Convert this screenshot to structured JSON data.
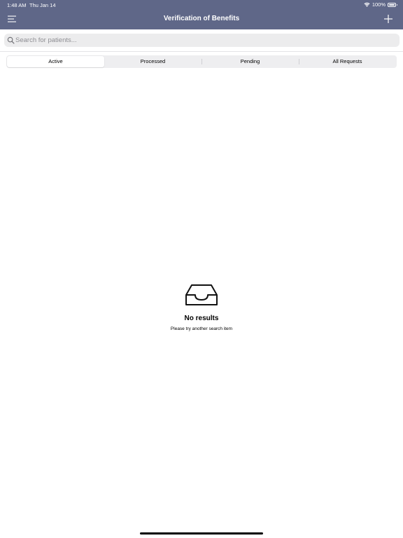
{
  "status_bar": {
    "time": "1:48 AM",
    "date": "Thu Jan 14",
    "battery": "100%",
    "wifi_icon": "wifi-icon",
    "battery_icon": "battery-icon"
  },
  "nav": {
    "title": "Verification of Benefits",
    "menu_icon": "menu-icon",
    "add_icon": "plus-icon"
  },
  "search": {
    "placeholder": "Search for patients...",
    "value": "",
    "icon": "search-icon"
  },
  "tabs": [
    {
      "label": "Active",
      "selected": true
    },
    {
      "label": "Processed",
      "selected": false
    },
    {
      "label": "Pending",
      "selected": false
    },
    {
      "label": "All Requests",
      "selected": false
    }
  ],
  "empty_state": {
    "icon": "inbox-icon",
    "title": "No results",
    "subtitle": "Please try another search item"
  },
  "colors": {
    "header_bg": "#5f6788",
    "header_text": "#ffffff",
    "search_bg": "#ececed",
    "segment_bg": "#eeeef0"
  }
}
